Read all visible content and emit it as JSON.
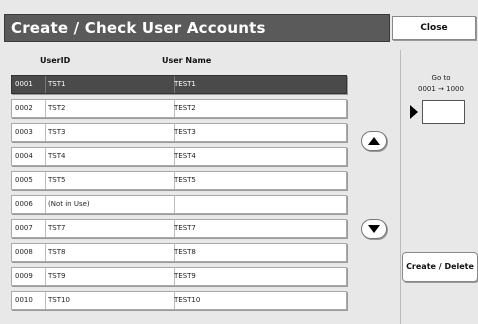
{
  "header": {
    "title": "Create / Check User Accounts",
    "close_label": "Close"
  },
  "table": {
    "columns": [
      "UserID",
      "User Name"
    ],
    "rows": [
      {
        "num": "0001",
        "id": "TST1",
        "name": "TEST1",
        "selected": true
      },
      {
        "num": "0002",
        "id": "TST2",
        "name": "TEST2"
      },
      {
        "num": "0003",
        "id": "TST3",
        "name": "TEST3"
      },
      {
        "num": "0004",
        "id": "TST4",
        "name": "TEST4"
      },
      {
        "num": "0005",
        "id": "TST5",
        "name": "TEST5"
      },
      {
        "num": "0006",
        "id": "(Not in Use)",
        "name": ""
      },
      {
        "num": "0007",
        "id": "TST7",
        "name": "TEST7"
      },
      {
        "num": "0008",
        "id": "TST8",
        "name": "TEST8"
      },
      {
        "num": "0009",
        "id": "TST9",
        "name": "TEST9"
      },
      {
        "num": "0010",
        "id": "TST10",
        "name": "TEST10"
      }
    ]
  },
  "scroll": {
    "up_icon": "chevron-up-icon",
    "down_icon": "chevron-down-icon"
  },
  "goto": {
    "label": "Go to",
    "range": "0001 → 1000",
    "value": ""
  },
  "actions": {
    "create_delete_label": "Create / Delete"
  },
  "colors": {
    "title_bg": "#5a5a5a",
    "selected_row_bg": "#4a4a4a",
    "screen_bg": "#e8e8e8"
  }
}
